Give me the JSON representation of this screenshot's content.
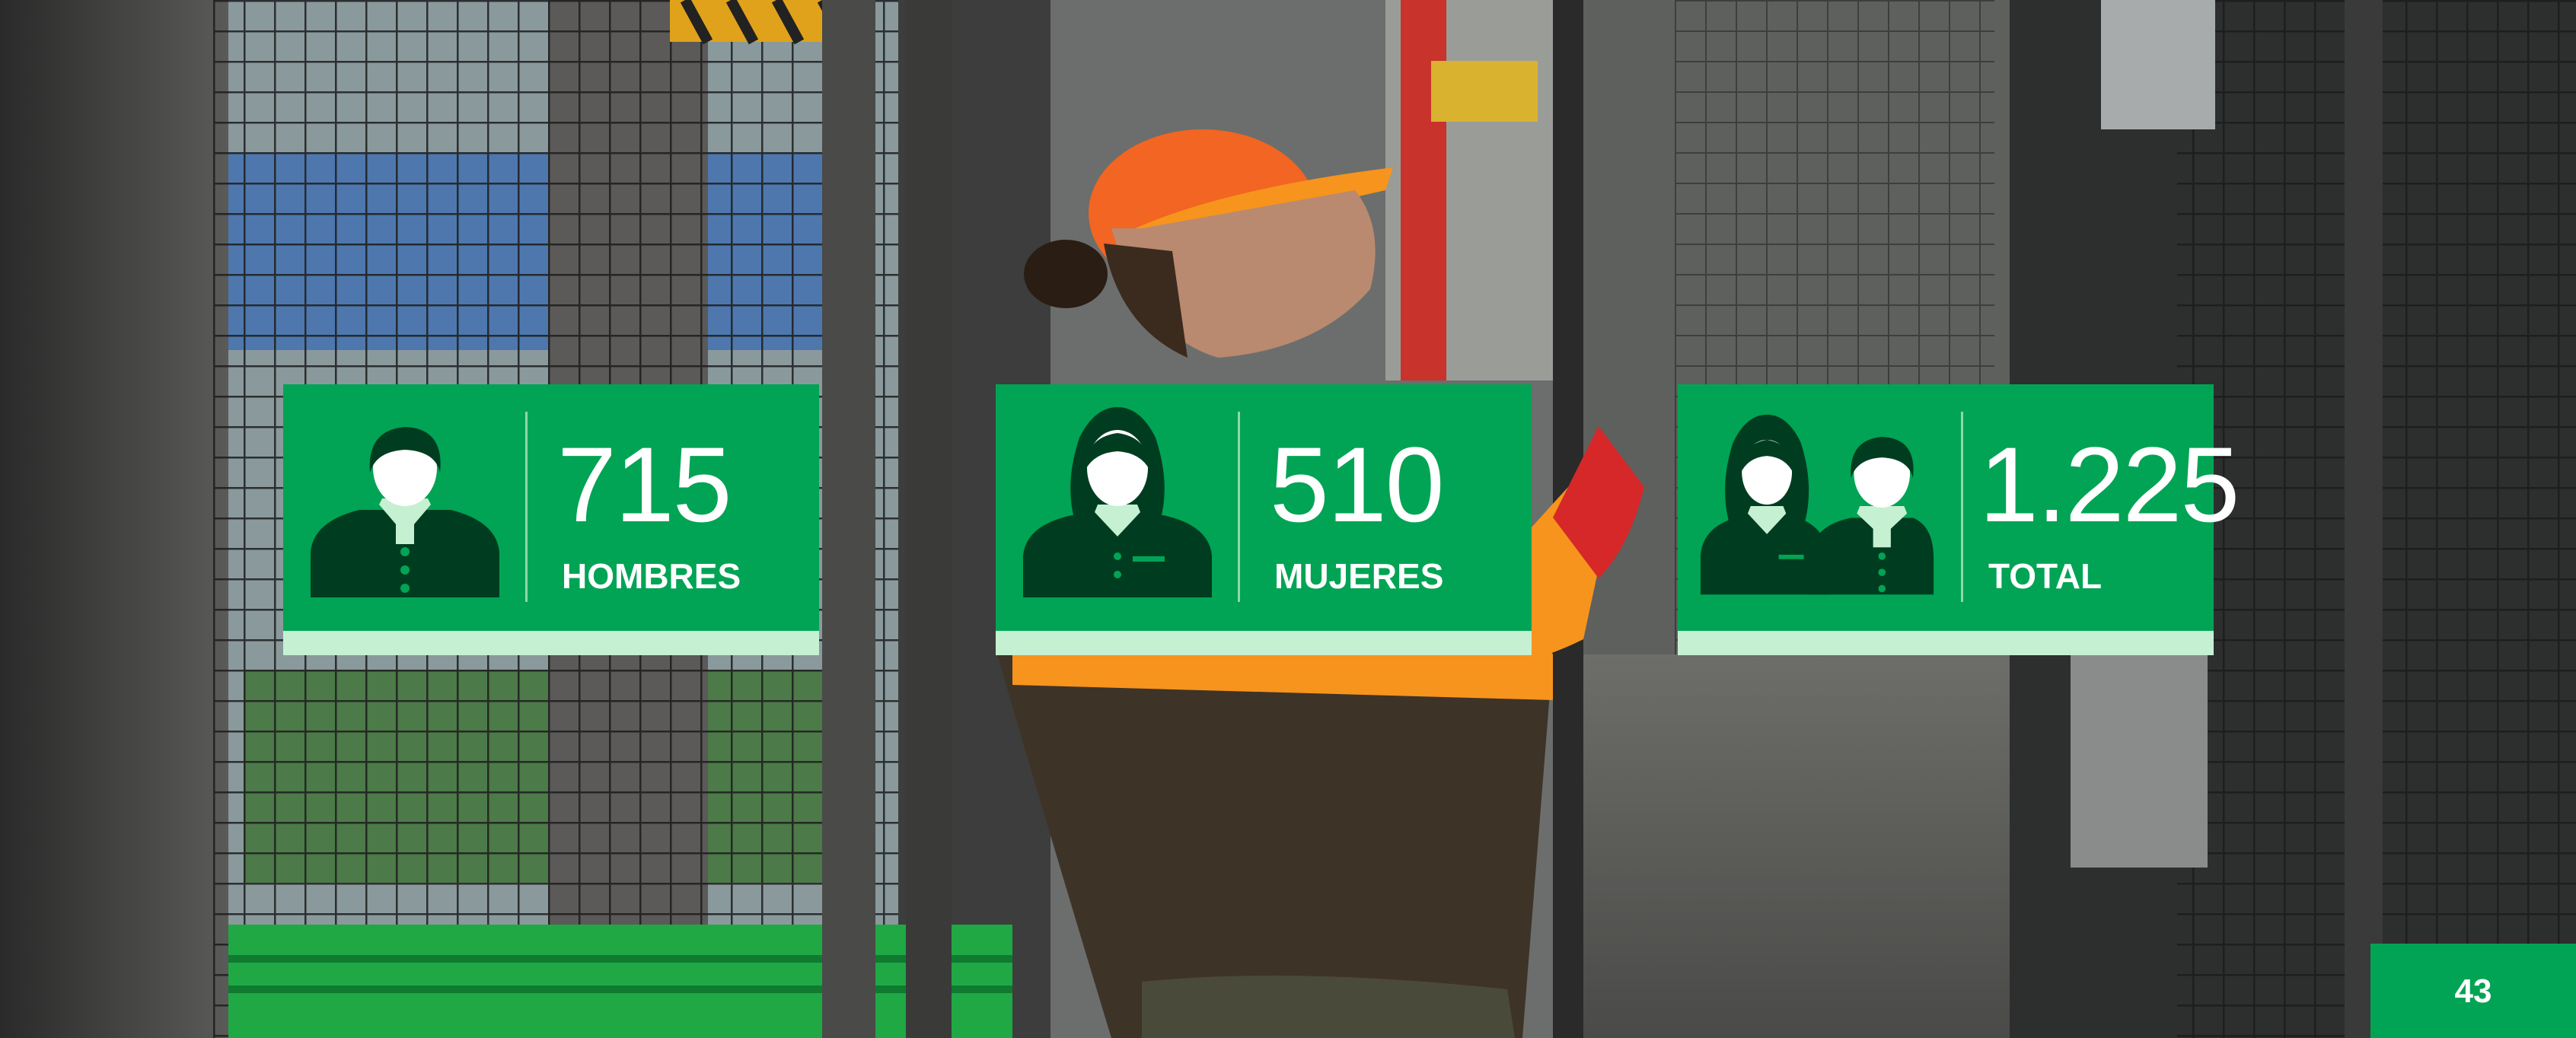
{
  "colors": {
    "card_green": "#00a454",
    "card_strip": "#c6f0d2",
    "icon_dark": "#003d20"
  },
  "stats": {
    "men": {
      "value": "715",
      "label": "HOMBRES",
      "icon": "man-silhouette-icon"
    },
    "women": {
      "value": "510",
      "label": "MUJERES",
      "icon": "woman-silhouette-icon"
    },
    "total": {
      "value": "1.225",
      "label": "TOTAL",
      "icon": "couple-silhouette-icon"
    }
  },
  "page": {
    "number": "43"
  }
}
